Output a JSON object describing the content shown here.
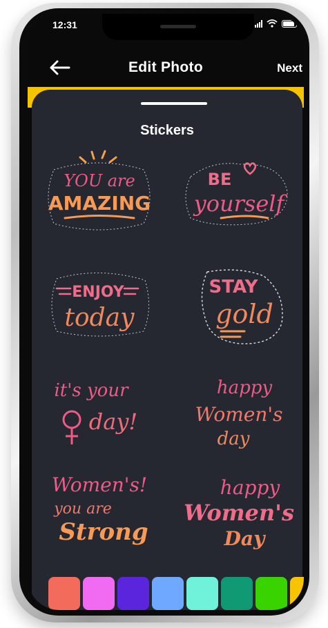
{
  "status": {
    "time": "12:31"
  },
  "header": {
    "title": "Edit Photo",
    "next_label": "Next"
  },
  "sheet": {
    "title": "Stickers"
  },
  "stickers": [
    {
      "lines": [
        "YOU are",
        "AMAZING"
      ]
    },
    {
      "lines": [
        "BE",
        "yourself"
      ]
    },
    {
      "lines": [
        "ENJOY",
        "today"
      ]
    },
    {
      "lines": [
        "STAY",
        "gold"
      ]
    },
    {
      "lines": [
        "it's your",
        "day!"
      ]
    },
    {
      "lines": [
        "happy",
        "Women's",
        "day"
      ]
    },
    {
      "lines": [
        "Women's!",
        "you are",
        "Strong"
      ]
    },
    {
      "lines": [
        "happy",
        "Women's",
        "Day"
      ]
    }
  ],
  "palette": [
    "#f26b5b",
    "#f06af2",
    "#5b24dd",
    "#6ea8ff",
    "#6ff2d9",
    "#0f9a74",
    "#39d300",
    "#f7c400"
  ]
}
